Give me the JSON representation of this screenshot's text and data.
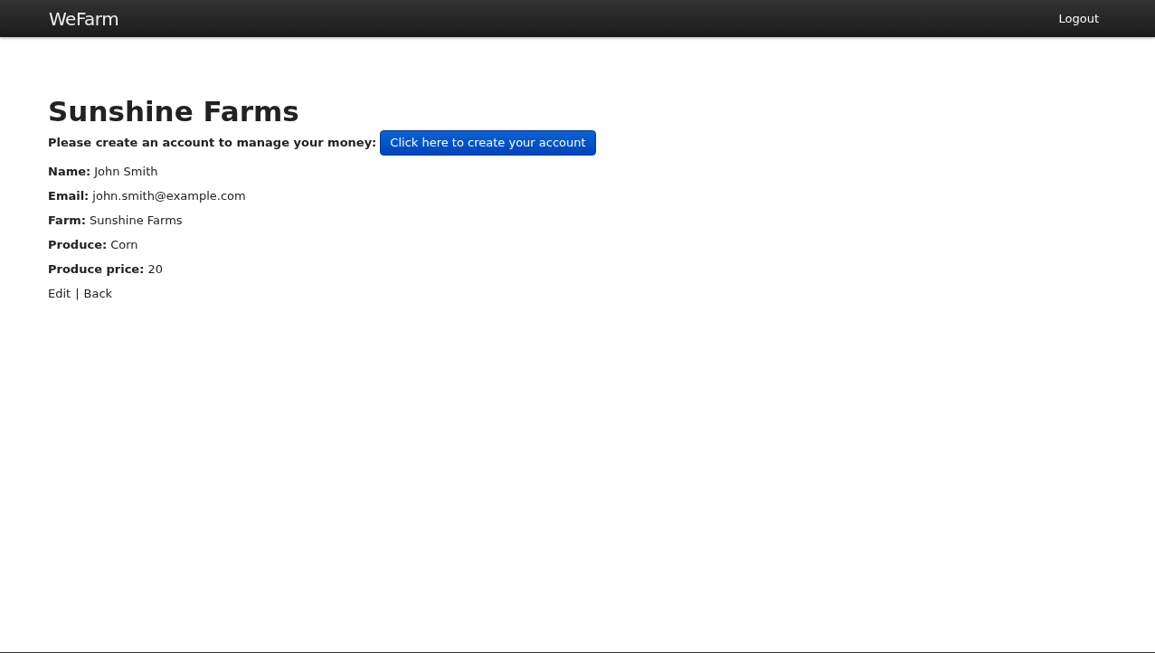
{
  "navbar": {
    "brand": "WeFarm",
    "logout": "Logout"
  },
  "title": "Sunshine Farms",
  "account_prompt": {
    "text": "Please create an account to manage your money:",
    "button": "Click here to create your account"
  },
  "fields": [
    {
      "label": "Name:",
      "value": "John Smith"
    },
    {
      "label": "Email:",
      "value": "john.smith@example.com"
    },
    {
      "label": "Farm:",
      "value": "Sunshine Farms"
    },
    {
      "label": "Produce:",
      "value": "Corn"
    },
    {
      "label": "Produce price:",
      "value": "20"
    }
  ],
  "links": {
    "edit": "Edit",
    "separator": "|",
    "back": "Back"
  }
}
